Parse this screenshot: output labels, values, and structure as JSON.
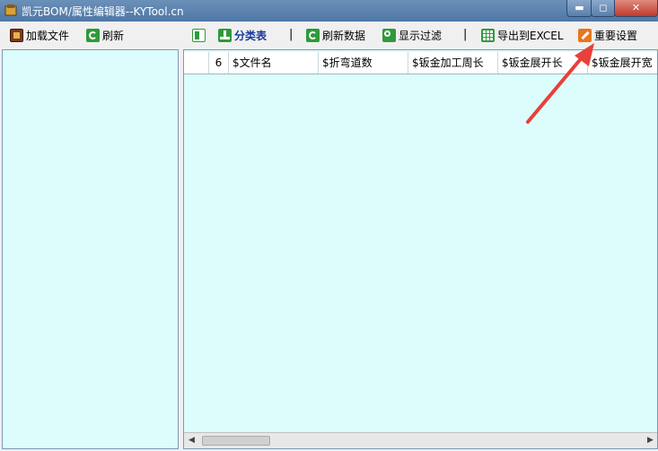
{
  "window": {
    "title": "凯元BOM/属性编辑器--KYTool.cn",
    "min_label": "▬",
    "max_label": "◻",
    "close_label": "✕"
  },
  "toolbar": {
    "load_file": "加载文件",
    "refresh": "刷新",
    "category_table": "分类表",
    "separator": "|",
    "refresh_data": "刷新数据",
    "show_filter": "显示过滤",
    "export_excel": "导出到EXCEL",
    "important_settings": "重要设置"
  },
  "grid": {
    "row_count": "6",
    "columns": [
      "$文件名",
      "$折弯道数",
      "$钣金加工周长",
      "$钣金展开长",
      "$钣金展开宽"
    ]
  },
  "colors": {
    "panel_bg": "#ddfdfd",
    "annotation_arrow": "#e8403a"
  },
  "icons": {
    "load": "load-file-icon",
    "refresh": "refresh-icon",
    "layout": "layout-icon",
    "tree": "category-tree-icon",
    "search": "filter-search-icon",
    "excel": "excel-grid-icon",
    "wrench": "wrench-icon"
  }
}
